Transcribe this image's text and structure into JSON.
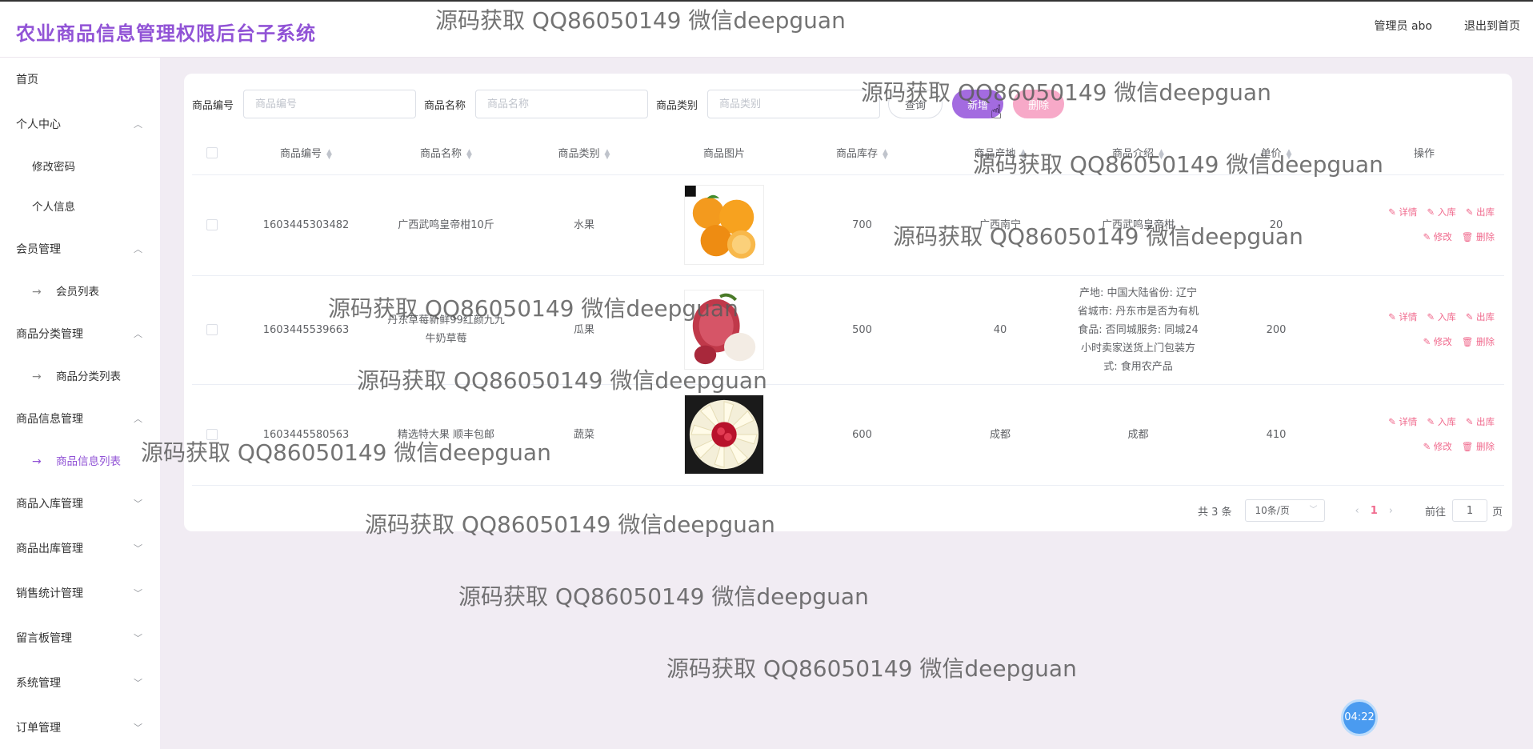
{
  "header": {
    "title": "农业商品信息管理权限后台子系统",
    "user": "管理员 abo",
    "exit": "退出到首页"
  },
  "sidebar": {
    "items": [
      {
        "label": "首页"
      },
      {
        "label": "个人中心"
      },
      {
        "label": "修改密码"
      },
      {
        "label": "个人信息"
      },
      {
        "label": "会员管理"
      },
      {
        "label": "会员列表"
      },
      {
        "label": "商品分类管理"
      },
      {
        "label": "商品分类列表"
      },
      {
        "label": "商品信息管理"
      },
      {
        "label": "商品信息列表"
      },
      {
        "label": "商品入库管理"
      },
      {
        "label": "商品出库管理"
      },
      {
        "label": "销售统计管理"
      },
      {
        "label": "留言板管理"
      },
      {
        "label": "系统管理"
      },
      {
        "label": "订单管理"
      }
    ]
  },
  "search": {
    "code_label": "商品编号",
    "code_placeholder": "商品编号",
    "name_label": "商品名称",
    "name_placeholder": "商品名称",
    "category_label": "商品类别",
    "category_placeholder": "商品类别",
    "query_button": "查询",
    "add_button": "新增",
    "delete_button": "删除"
  },
  "table": {
    "headers": [
      "商品编号",
      "商品名称",
      "商品类别",
      "商品图片",
      "商品库存",
      "商品产地",
      "商品介绍",
      "单价",
      "操作"
    ],
    "rows": [
      {
        "code": "1603445303482",
        "name": "广西武鸣皇帝柑10斤",
        "category": "水果",
        "image": "oranges",
        "stock": "700",
        "origin": "广西南宁",
        "intro": "广西武鸣皇帝柑",
        "price": "20"
      },
      {
        "code": "1603445539663",
        "name": "丹东草莓新鲜99红颜九九牛奶草莓",
        "category": "瓜果",
        "image": "lychee",
        "stock": "500",
        "origin": "40",
        "intro": "产地: 中国大陆省份: 辽宁省城市: 丹东市是否为有机食品: 否同城服务: 同城24小时卖家送货上门包装方式: 食用农产品",
        "price": "200"
      },
      {
        "code": "1603445580563",
        "name": "精选特大果 顺丰包邮",
        "category": "蔬菜",
        "image": "fruit-platter",
        "stock": "600",
        "origin": "成都",
        "intro": "成都",
        "price": "410"
      }
    ],
    "ops": {
      "detail": "详情",
      "in": "入库",
      "out": "出库",
      "edit": "修改",
      "delete": "删除"
    }
  },
  "pagination": {
    "total": "共 3 条",
    "page_size": "10条/页",
    "current_page": "1",
    "goto_prefix": "前往",
    "goto_value": "1",
    "goto_suffix": "页"
  },
  "watermark": "源码获取 QQ86050149 微信deepguan",
  "timer": "04:22",
  "colors": {
    "accent": "#9153d6",
    "add": "#a36be0",
    "delete": "#f7a9c8",
    "link": "#f06a8d",
    "background": "#f1ecf3"
  }
}
